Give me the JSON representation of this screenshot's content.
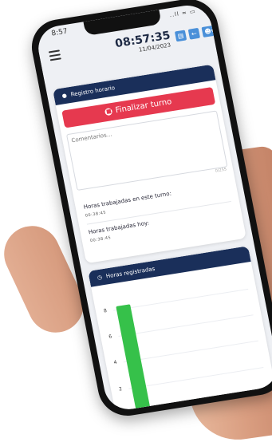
{
  "status": {
    "time": "8:57",
    "icons": "..ll ≈ ▭"
  },
  "header": {
    "time": "08:57:35",
    "date": "11/04/2023"
  },
  "registro": {
    "title": "Registro horario",
    "finalizar_label": "Finalizar turno",
    "comment_placeholder": "Comentarios...",
    "counter": "0/255",
    "turno_label": "Horas trabajadas en este turno:",
    "turno_value": "00:38:45",
    "hoy_label": "Horas trabajadas hoy:",
    "hoy_value": "00:38:45"
  },
  "horas": {
    "title": "Horas registradas"
  },
  "chart_data": {
    "type": "bar",
    "y_ticks": [
      "8",
      "6",
      "4",
      "2"
    ],
    "ylim": [
      0,
      9
    ],
    "series": [
      {
        "values": [
          8.2
        ]
      }
    ],
    "bar_color": "#36c14a"
  },
  "colors": {
    "header": "#1a2f5a",
    "danger": "#e6394f",
    "accent": "#4a90d9",
    "bar": "#36c14a"
  }
}
